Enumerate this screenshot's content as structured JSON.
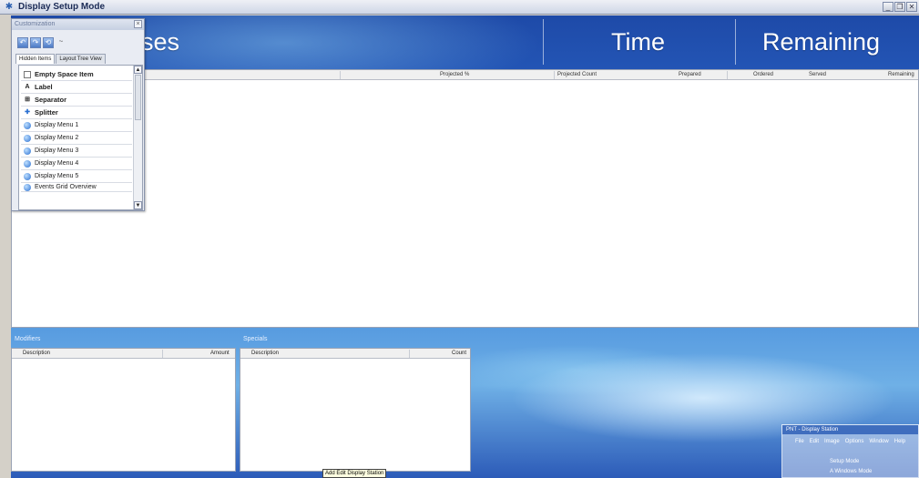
{
  "window": {
    "title": "Display Setup Mode"
  },
  "header": {
    "labels": [
      "ses",
      "Time",
      "Remaining"
    ]
  },
  "grid": {
    "columns": [
      "Projected %",
      "Projected Count",
      "Prepared",
      "Ordered",
      "Served",
      "Remaining"
    ]
  },
  "customization": {
    "title": "Customization",
    "tabs": [
      "Hidden Items",
      "Layout Tree View"
    ],
    "items": [
      {
        "label": "Empty Space Item",
        "icon": "empty-space-icon",
        "bold": true
      },
      {
        "label": "Label",
        "icon": "label-a-icon",
        "bold": true
      },
      {
        "label": "Separator",
        "icon": "separator-icon",
        "bold": true
      },
      {
        "label": "Splitter",
        "icon": "splitter-icon",
        "bold": true
      },
      {
        "label": "Display Menu 1",
        "icon": "globe-icon",
        "bold": false
      },
      {
        "label": "Display Menu 2",
        "icon": "globe-icon",
        "bold": false
      },
      {
        "label": "Display Menu 3",
        "icon": "globe-icon",
        "bold": false
      },
      {
        "label": "Display Menu 4",
        "icon": "globe-icon",
        "bold": false
      },
      {
        "label": "Display Menu 5",
        "icon": "globe-icon",
        "bold": false
      },
      {
        "label": "Events Grid Overview",
        "icon": "globe-icon",
        "bold": false
      }
    ]
  },
  "left_panel": {
    "title": "Modifiers",
    "columns": [
      "Description",
      "Amount"
    ]
  },
  "mid_panel": {
    "title": "Specials",
    "columns": [
      "Description",
      "Count"
    ]
  },
  "tooltip": {
    "text": "Add Edit Display Station"
  },
  "mini_window": {
    "title": "PNT - Display Station",
    "menu": [
      "File",
      "Edit",
      "Image",
      "Options",
      "Window",
      "Help"
    ],
    "row1": "Setup Mode",
    "row2": "A Windows Mode"
  },
  "colors": {
    "accent": "#2b66c9",
    "window_bg": "#d4d0c8"
  }
}
